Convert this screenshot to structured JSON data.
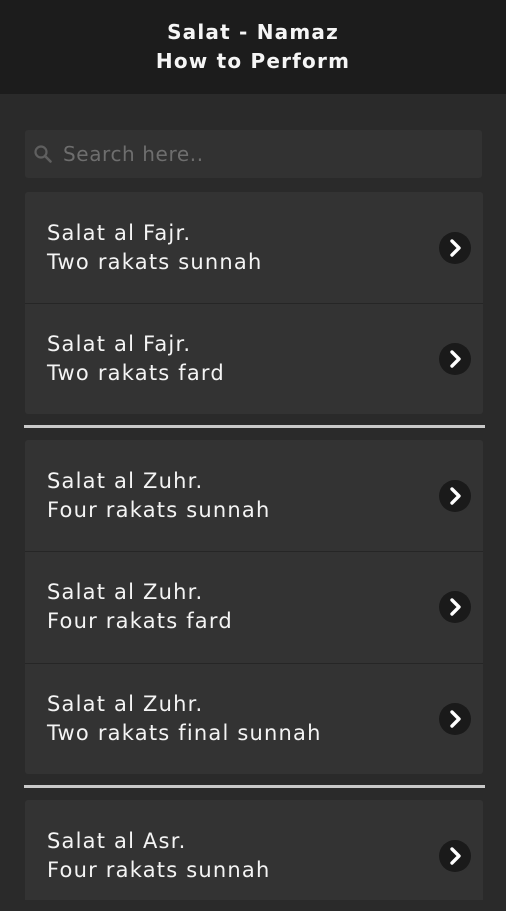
{
  "header": {
    "title_line1": "Salat - Namaz",
    "title_line2": "How to Perform"
  },
  "search": {
    "placeholder": "Search here.."
  },
  "groups": [
    {
      "items": [
        {
          "line1": "Salat al Fajr.",
          "line2": "Two rakats sunnah"
        },
        {
          "line1": "Salat al Fajr.",
          "line2": "Two rakats fard"
        }
      ]
    },
    {
      "items": [
        {
          "line1": "Salat al Zuhr.",
          "line2": "Four rakats sunnah"
        },
        {
          "line1": "Salat al Zuhr.",
          "line2": "Four rakats fard"
        },
        {
          "line1": "Salat al Zuhr.",
          "line2": "Two rakats final sunnah"
        }
      ]
    },
    {
      "items": [
        {
          "line1": "Salat al Asr.",
          "line2": "Four rakats sunnah"
        }
      ]
    }
  ]
}
